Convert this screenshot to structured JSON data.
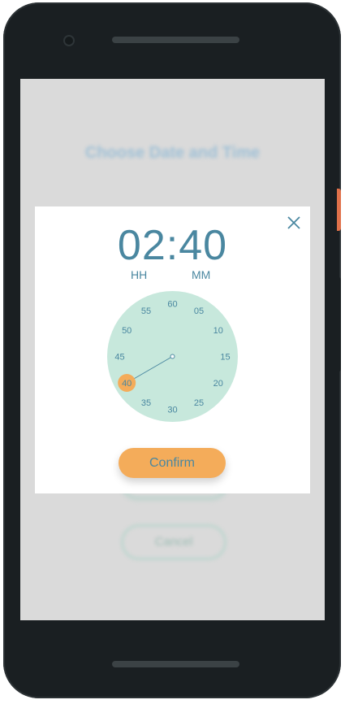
{
  "screen": {
    "background_title": "Choose Date and Time",
    "background_cancel_label": "Cancel"
  },
  "dialog": {
    "time": "02:40",
    "hours_label": "HH",
    "minutes_label": "MM",
    "confirm_label": "Confirm",
    "close_icon": "close-icon"
  },
  "clock": {
    "selected_minute": "40",
    "ticks": [
      "60",
      "05",
      "10",
      "15",
      "20",
      "25",
      "30",
      "35",
      "40",
      "45",
      "50",
      "55"
    ]
  },
  "colors": {
    "accent": "#4a87a0",
    "clock_face": "#c7e8dc",
    "selection": "#f4ac5a",
    "device_side_button": "#e0714a"
  }
}
